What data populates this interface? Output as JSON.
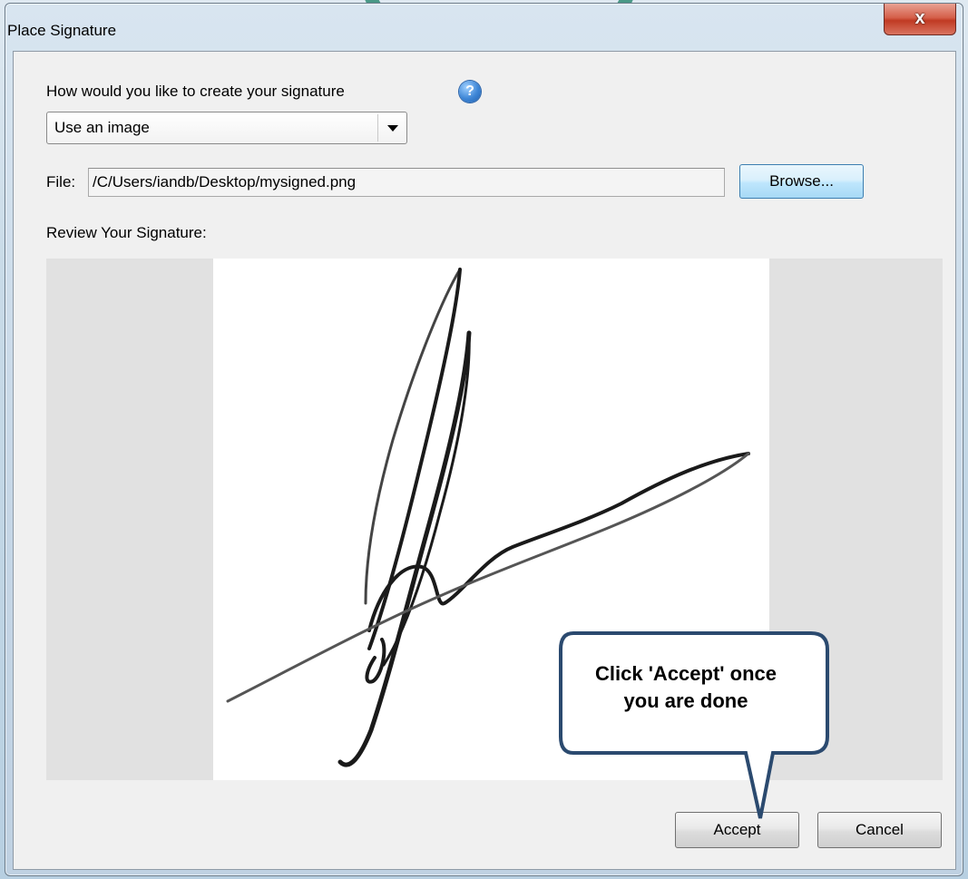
{
  "window": {
    "title": "Place Signature",
    "close_label": "x"
  },
  "signature_method": {
    "prompt": "How would you like to create your signature",
    "help_icon": "?",
    "selected_option": "Use an image"
  },
  "file": {
    "label": "File:",
    "value": "/C/Users/iandb/Desktop/mysigned.png",
    "browse_label": "Browse..."
  },
  "review": {
    "label": "Review Your Signature:"
  },
  "callout": {
    "line1": "Click 'Accept' once",
    "line2": "you are done"
  },
  "actions": {
    "accept_label": "Accept",
    "cancel_label": "Cancel"
  },
  "colors": {
    "dialog_bg": "#f0f0f0",
    "preview_bg": "#e1e1e1",
    "callout_border": "#2b4a6f",
    "close_button": "#c8432c"
  }
}
